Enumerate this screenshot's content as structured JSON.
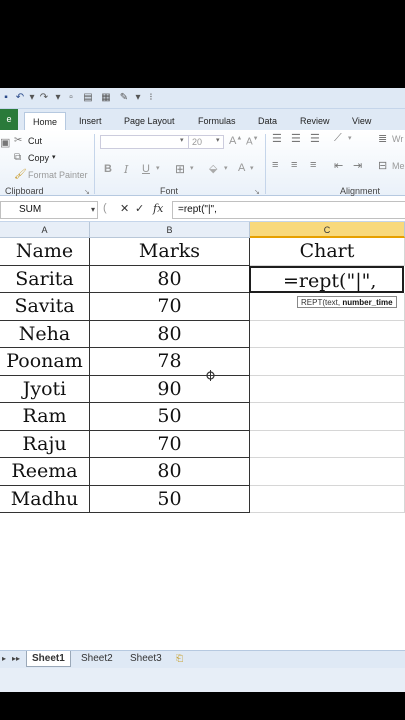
{
  "ribbon": {
    "tabs": [
      "Home",
      "Insert",
      "Page Layout",
      "Formulas",
      "Data",
      "Review",
      "View"
    ],
    "clipboard": {
      "cut": "Cut",
      "copy": "Copy",
      "format_painter": "Format Painter",
      "label": "Clipboard"
    },
    "font": {
      "size": "20",
      "bold": "B",
      "italic": "I",
      "underline": "U",
      "label": "Font"
    },
    "alignment": {
      "label": "Alignment",
      "wrap": "Wr",
      "merge": "Me"
    }
  },
  "formula_bar": {
    "name_box": "SUM",
    "cancel": "✕",
    "enter": "✓",
    "fx": "fx",
    "formula": "=rept(\"|\","
  },
  "grid": {
    "columns": [
      "A",
      "B",
      "C"
    ],
    "header_row": {
      "name": "Name",
      "marks": "Marks",
      "chart": "Chart"
    },
    "rows": [
      {
        "name": "Sarita",
        "marks": "80"
      },
      {
        "name": "Savita",
        "marks": "70"
      },
      {
        "name": "Neha",
        "marks": "80"
      },
      {
        "name": "Poonam",
        "marks": "78"
      },
      {
        "name": "Jyoti",
        "marks": "90"
      },
      {
        "name": "Ram",
        "marks": "50"
      },
      {
        "name": "Raju",
        "marks": "70"
      },
      {
        "name": "Reema",
        "marks": "80"
      },
      {
        "name": "Madhu",
        "marks": "50"
      }
    ],
    "editing_cell": "=rept(\"|\",",
    "tooltip": {
      "fn": "REPT(text, ",
      "arg": "number_time"
    }
  },
  "sheets": [
    "Sheet1",
    "Sheet2",
    "Sheet3"
  ]
}
